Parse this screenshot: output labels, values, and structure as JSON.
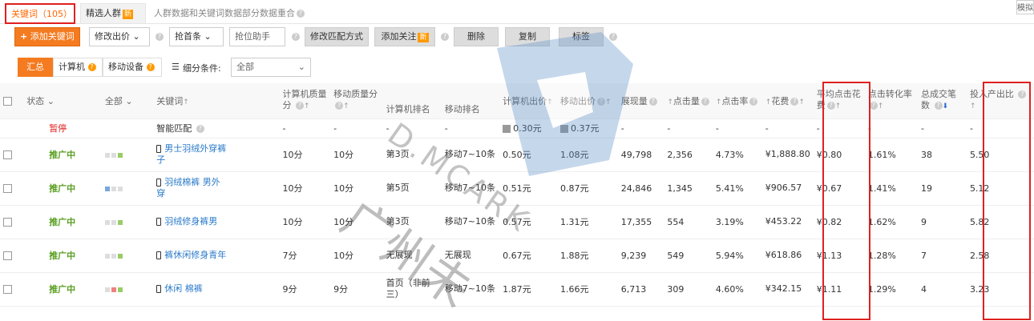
{
  "tabs": {
    "keywords": "关键词（105）",
    "crowd": "精选人群",
    "crowd_badge": "新",
    "notice": "人群数据和关键词数据部分数据重合",
    "mode": "模拟"
  },
  "toolbar": {
    "add_keyword": "添加关键词",
    "modify_bid": "修改出价",
    "grab_first": "抢首条",
    "grab_assist": "抢位助手",
    "modify_match": "修改匹配方式",
    "add_follow": "添加关注",
    "follow_badge": "新",
    "delete": "删除",
    "copy": "复制",
    "tag": "标签"
  },
  "filter": {
    "summary": "汇总",
    "pc": "计算机",
    "mobile": "移动设备",
    "condition_label": "细分条件:",
    "condition_value": "全部"
  },
  "columns": {
    "status": "状态",
    "all": "全部",
    "keyword": "关键词",
    "pc_quality": "计算机质量分",
    "mobile_quality": "移动质量分",
    "pc_rank": "计算机排名",
    "mobile_rank": "移动排名",
    "pc_bid": "计算机出价",
    "mobile_bid": "移动出价",
    "impressions": "展现量",
    "clicks": "点击量",
    "ctr": "点击率",
    "cost": "花费",
    "avg_cpc": "平均点击花费",
    "conv_rate": "点击转化率",
    "orders": "总成交笔数",
    "roi": "投入产出比"
  },
  "smart_row": {
    "status": "暂停",
    "keyword": "智能匹配",
    "pc_bid": "0.30元",
    "mobile_bid": "0.37元",
    "dash": "-"
  },
  "rows": [
    {
      "status": "推广中",
      "keyword": "男士羽绒外穿裤子",
      "pc_quality": "10分",
      "mobile_quality": "10分",
      "pc_rank": "第3页",
      "mobile_rank": "移动7~10条",
      "pc_bid": "0.50元",
      "mobile_bid": "1.08元",
      "impressions": "49,798",
      "clicks": "2,356",
      "ctr": "4.73%",
      "cost": "¥1,888.80",
      "avg_cpc": "¥0.80",
      "conv_rate": "1.61%",
      "orders": "38",
      "roi": "5.50",
      "squares": [
        "#ddd",
        "#ddd",
        "#9c6"
      ]
    },
    {
      "status": "推广中",
      "keyword": "羽绒棉裤 男外穿",
      "pc_quality": "10分",
      "mobile_quality": "10分",
      "pc_rank": "第5页",
      "mobile_rank": "移动7~10条",
      "pc_bid": "0.51元",
      "mobile_bid": "0.87元",
      "impressions": "24,846",
      "clicks": "1,345",
      "ctr": "5.41%",
      "cost": "¥906.57",
      "avg_cpc": "¥0.67",
      "conv_rate": "1.41%",
      "orders": "19",
      "roi": "5.12",
      "squares": [
        "#7aa6d9",
        "#ddd",
        "#ddd"
      ]
    },
    {
      "status": "推广中",
      "keyword": "羽绒修身裤男",
      "pc_quality": "10分",
      "mobile_quality": "10分",
      "pc_rank": "第3页",
      "mobile_rank": "移动7~10条",
      "pc_bid": "0.57元",
      "mobile_bid": "1.31元",
      "impressions": "17,355",
      "clicks": "554",
      "ctr": "3.19%",
      "cost": "¥453.22",
      "avg_cpc": "¥0.82",
      "conv_rate": "1.62%",
      "orders": "9",
      "roi": "5.82",
      "squares": [
        "#ddd",
        "#ddd",
        "#9c6"
      ]
    },
    {
      "status": "推广中",
      "keyword": "裤休闲修身青年",
      "pc_quality": "7分",
      "mobile_quality": "10分",
      "pc_rank": "无展现",
      "mobile_rank": "无展现",
      "pc_bid": "0.67元",
      "mobile_bid": "1.88元",
      "impressions": "9,239",
      "clicks": "549",
      "ctr": "5.94%",
      "cost": "¥618.86",
      "avg_cpc": "¥1.13",
      "conv_rate": "1.28%",
      "orders": "7",
      "roi": "2.58",
      "squares": [
        "#ddd",
        "#ddd",
        "#9c6"
      ]
    },
    {
      "status": "推广中",
      "keyword": "休闲 棉裤",
      "pc_quality": "9分",
      "mobile_quality": "9分",
      "pc_rank": "首页（非前三）",
      "mobile_rank": "移动7~10条",
      "pc_bid": "1.87元",
      "mobile_bid": "1.66元",
      "impressions": "6,713",
      "clicks": "309",
      "ctr": "4.60%",
      "cost": "¥342.15",
      "avg_cpc": "¥1.11",
      "conv_rate": "1.29%",
      "orders": "4",
      "roi": "3.23",
      "squares": [
        "#ddd",
        "#f08080",
        "#9c6"
      ]
    }
  ],
  "watermark": {
    "text1": "D.MCARK",
    "text2": "广州未"
  }
}
